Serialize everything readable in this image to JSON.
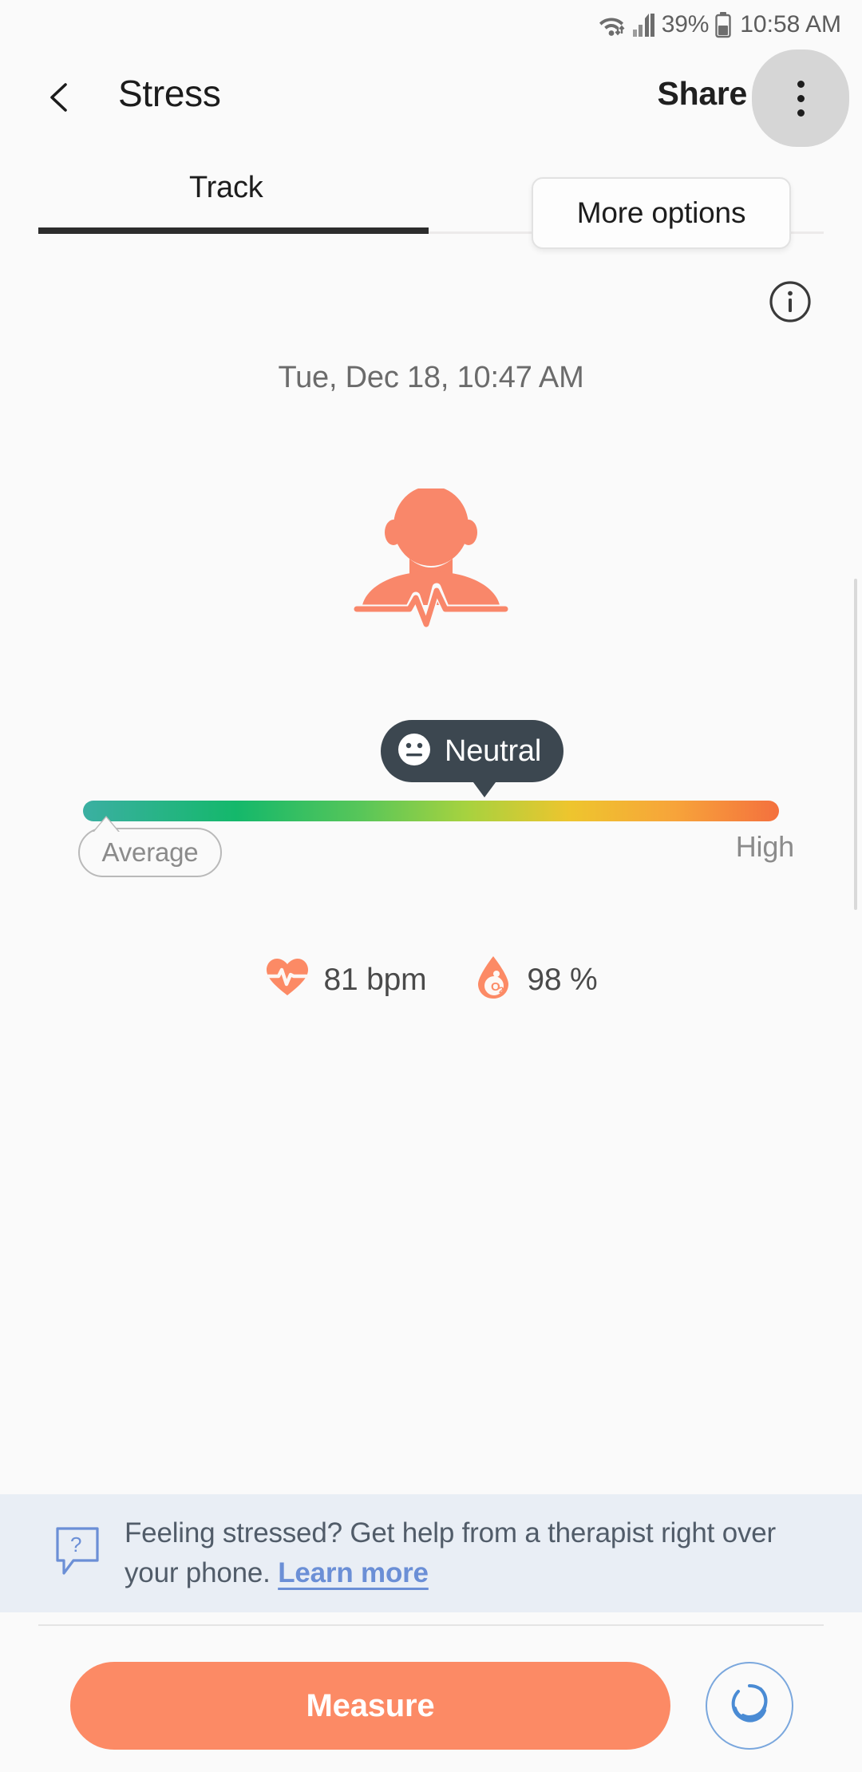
{
  "status_bar": {
    "wifi_icon": "wifi-icon",
    "signal_icon": "cellular-signal-icon",
    "battery_percent": "39%",
    "battery_icon": "battery-icon",
    "time": "10:58 AM"
  },
  "app_bar": {
    "back_icon": "back-chevron-icon",
    "title": "Stress",
    "share_label": "Share",
    "overflow_icon": "overflow-menu-icon"
  },
  "tabs": {
    "items": [
      {
        "label": "Track",
        "active": true
      }
    ],
    "tooltip": "More options"
  },
  "content": {
    "info_icon": "info-icon",
    "date": "Tue, Dec 18, 10:47 AM",
    "avatar_icon": "person-pulse-icon",
    "stress_level": {
      "label": "Neutral",
      "face_icon": "neutral-face-icon",
      "marker_percent": 55,
      "scale_low_label": "Average",
      "scale_high_label": "High",
      "gradient_start": "#3bafa2",
      "gradient_end": "#f4703e"
    },
    "metrics": [
      {
        "icon": "heart-rate-icon",
        "value": "81 bpm",
        "color": "#fc8a65"
      },
      {
        "icon": "blood-oxygen-icon",
        "value": "98 %",
        "color": "#fc8a65"
      }
    ]
  },
  "promo": {
    "icon": "question-bubble-icon",
    "text": "Feeling stressed? Get help from a therapist right over your phone. ",
    "link_label": "Learn more",
    "link_color": "#6b8fd6",
    "background": "#e9eef5"
  },
  "bottom_bar": {
    "measure_label": "Measure",
    "measure_color": "#fc8a65",
    "companion_icon": "calm-swirl-icon"
  }
}
